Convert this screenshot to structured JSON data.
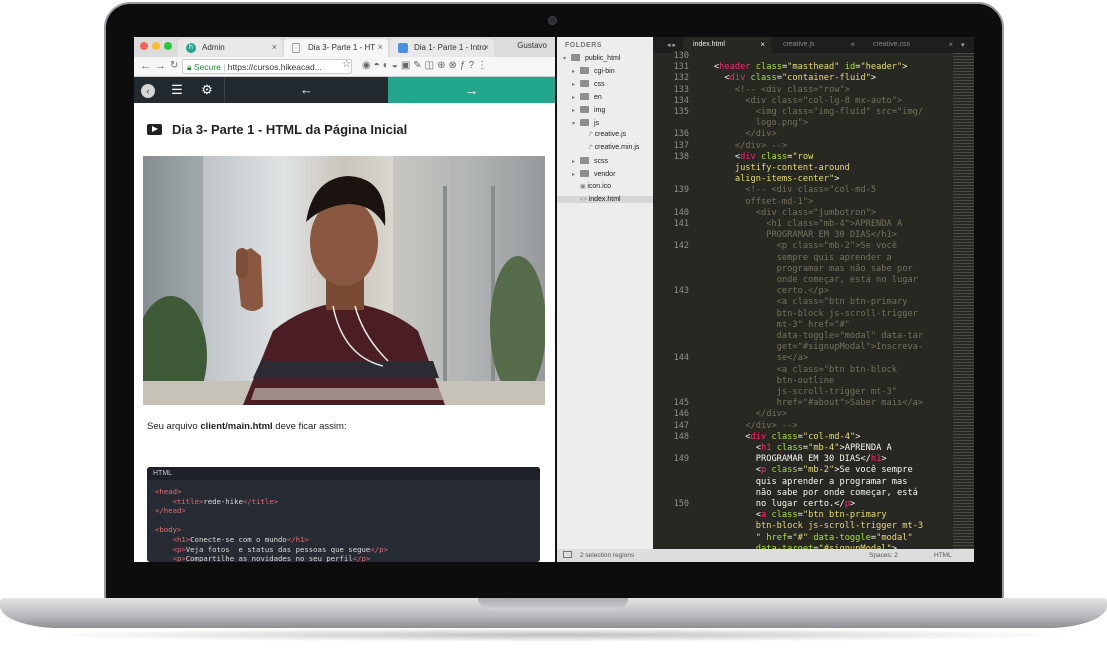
{
  "browser": {
    "tabs": [
      {
        "label": "Admin",
        "icon": "hike-logo-icon"
      },
      {
        "label": "Dia 3- Parte 1 - HT",
        "icon": "page-icon"
      },
      {
        "label": "Dia 1- Parte 1 - Intro",
        "icon": "page-icon"
      }
    ],
    "user": "Gustavo",
    "secure_label": "Secure",
    "url": "https://cursos.hikeacad...",
    "lesson_title": "Dia 3- Parte 1 - HTML da Página Inicial",
    "paragraph_prefix": "Seu arquivo ",
    "paragraph_file": "client/main.html",
    "paragraph_suffix": " deve ficar assim:",
    "code_lang": "HTML",
    "code_lines": [
      {
        "indent": "",
        "open": "<head>",
        "text": "",
        "close": ""
      },
      {
        "indent": "    ",
        "open": "<title>",
        "text": "rede-hike",
        "close": "</title>"
      },
      {
        "indent": "",
        "open": "</head>",
        "text": "",
        "close": ""
      },
      {
        "indent": "",
        "open": "",
        "text": "",
        "close": ""
      },
      {
        "indent": "",
        "open": "<body>",
        "text": "",
        "close": ""
      },
      {
        "indent": "    ",
        "open": "<h1>",
        "text": "Conecte-se com o mundo",
        "close": "</h1>"
      },
      {
        "indent": "    ",
        "open": "<p>",
        "text": "Veja fotos  e status das pessoas que segue",
        "close": "</p>"
      },
      {
        "indent": "    ",
        "open": "<p>",
        "text": "Compartilhe as novidades no seu perfil",
        "close": "</p>"
      }
    ]
  },
  "editor": {
    "folders_label": "FOLDERS",
    "tree": [
      {
        "label": "public_html",
        "depth": 0,
        "type": "folder",
        "open": true
      },
      {
        "label": "cgi-bin",
        "depth": 1,
        "type": "folder"
      },
      {
        "label": "css",
        "depth": 1,
        "type": "folder"
      },
      {
        "label": "en",
        "depth": 1,
        "type": "folder"
      },
      {
        "label": "img",
        "depth": 1,
        "type": "folder"
      },
      {
        "label": "js",
        "depth": 1,
        "type": "folder",
        "open": true
      },
      {
        "label": "creative.js",
        "depth": 2,
        "type": "file"
      },
      {
        "label": "creative.min.js",
        "depth": 2,
        "type": "file"
      },
      {
        "label": "scss",
        "depth": 1,
        "type": "folder"
      },
      {
        "label": "vendor",
        "depth": 1,
        "type": "folder"
      },
      {
        "label": "icon.ico",
        "depth": 1,
        "type": "file"
      },
      {
        "label": "index.html",
        "depth": 1,
        "type": "file",
        "selected": true
      }
    ],
    "tabs": [
      {
        "label": "index.html",
        "active": true
      },
      {
        "label": "creative.js",
        "active": false
      },
      {
        "label": "creative.css",
        "active": false
      }
    ],
    "line_numbers": [
      {
        "n": "130",
        "row": 0
      },
      {
        "n": "131",
        "row": 1
      },
      {
        "n": "132",
        "row": 2
      },
      {
        "n": "133",
        "row": 3
      },
      {
        "n": "134",
        "row": 4
      },
      {
        "n": "135",
        "row": 5
      },
      {
        "n": "136",
        "row": 7
      },
      {
        "n": "137",
        "row": 8
      },
      {
        "n": "138",
        "row": 9
      },
      {
        "n": "139",
        "row": 12
      },
      {
        "n": "140",
        "row": 14
      },
      {
        "n": "141",
        "row": 15
      },
      {
        "n": "142",
        "row": 17
      },
      {
        "n": "143",
        "row": 21
      },
      {
        "n": "144",
        "row": 27
      },
      {
        "n": "145",
        "row": 31
      },
      {
        "n": "146",
        "row": 32
      },
      {
        "n": "147",
        "row": 33
      },
      {
        "n": "148",
        "row": 34
      },
      {
        "n": "149",
        "row": 36
      },
      {
        "n": "150",
        "row": 40
      }
    ],
    "code_lines": [
      [
        {
          "c": "w",
          "t": ""
        }
      ],
      [
        {
          "c": "w",
          "t": "    <"
        },
        {
          "c": "k",
          "t": "header"
        },
        {
          "c": "a",
          "t": " class"
        },
        {
          "c": "w",
          "t": "="
        },
        {
          "c": "s",
          "t": "\"masthead\""
        },
        {
          "c": "a",
          "t": " id"
        },
        {
          "c": "w",
          "t": "="
        },
        {
          "c": "s",
          "t": "\"header\""
        },
        {
          "c": "w",
          "t": ">"
        }
      ],
      [
        {
          "c": "w",
          "t": "      <"
        },
        {
          "c": "k",
          "t": "div"
        },
        {
          "c": "a",
          "t": " class"
        },
        {
          "c": "w",
          "t": "="
        },
        {
          "c": "s",
          "t": "\"container-fluid\""
        },
        {
          "c": "w",
          "t": ">"
        }
      ],
      [
        {
          "c": "c",
          "t": "        <!-- <div class=\"row\">"
        }
      ],
      [
        {
          "c": "c",
          "t": "          <div class=\"col-lg-8 mx-auto\">"
        }
      ],
      [
        {
          "c": "c",
          "t": "            <img class=\"img-fluid\" src=\"img/"
        }
      ],
      [
        {
          "c": "c",
          "t": "            logo.png\">"
        }
      ],
      [
        {
          "c": "c",
          "t": "          </div>"
        }
      ],
      [
        {
          "c": "c",
          "t": "        </div> -->"
        }
      ],
      [
        {
          "c": "w",
          "t": "        <"
        },
        {
          "c": "k",
          "t": "div"
        },
        {
          "c": "a",
          "t": " class"
        },
        {
          "c": "w",
          "t": "="
        },
        {
          "c": "s",
          "t": "\"row"
        }
      ],
      [
        {
          "c": "s",
          "t": "        justify-content-around"
        }
      ],
      [
        {
          "c": "s",
          "t": "        align-items-center\""
        },
        {
          "c": "w",
          "t": ">"
        }
      ],
      [
        {
          "c": "c",
          "t": "          <!-- <div class=\"col-md-5"
        }
      ],
      [
        {
          "c": "c",
          "t": "          offset-md-1\">"
        }
      ],
      [
        {
          "c": "c",
          "t": "            <div class=\"jumbotron\">"
        }
      ],
      [
        {
          "c": "c",
          "t": "              <h1 class=\"mb-4\">APRENDA A"
        }
      ],
      [
        {
          "c": "c",
          "t": "              PROGRAMAR EM 30 DIAS</h1>"
        }
      ],
      [
        {
          "c": "c",
          "t": "                <p class=\"mb-2\">Se você"
        }
      ],
      [
        {
          "c": "c",
          "t": "                sempre quis aprender a"
        }
      ],
      [
        {
          "c": "c",
          "t": "                programar mas não sabe por"
        }
      ],
      [
        {
          "c": "c",
          "t": "                onde começar, está no lugar"
        }
      ],
      [
        {
          "c": "c",
          "t": "                certo.</p>"
        }
      ],
      [
        {
          "c": "c",
          "t": "                <a class=\"btn btn-primary"
        }
      ],
      [
        {
          "c": "c",
          "t": "                btn-block js-scroll-trigger"
        }
      ],
      [
        {
          "c": "c",
          "t": "                mt-3\" href=\"#\""
        }
      ],
      [
        {
          "c": "c",
          "t": "                data-toggle=\"modal\" data-tar"
        }
      ],
      [
        {
          "c": "c",
          "t": "                get=\"#signupModal\">Inscreva-"
        }
      ],
      [
        {
          "c": "c",
          "t": "                se</a>"
        }
      ],
      [
        {
          "c": "c",
          "t": "                <a class=\"btn btn-block"
        }
      ],
      [
        {
          "c": "c",
          "t": "                btn-outline"
        }
      ],
      [
        {
          "c": "c",
          "t": "                js-scroll-trigger mt-3\""
        }
      ],
      [
        {
          "c": "c",
          "t": "                href=\"#about\">Saber mais</a>"
        }
      ],
      [
        {
          "c": "c",
          "t": "            </div>"
        }
      ],
      [
        {
          "c": "c",
          "t": "          </div> -->"
        }
      ],
      [
        {
          "c": "w",
          "t": "          <"
        },
        {
          "c": "k",
          "t": "div"
        },
        {
          "c": "a",
          "t": " class"
        },
        {
          "c": "w",
          "t": "="
        },
        {
          "c": "s",
          "t": "\"col-md-4\""
        },
        {
          "c": "w",
          "t": ">"
        }
      ],
      [
        {
          "c": "w",
          "t": "            <"
        },
        {
          "c": "k",
          "t": "h1"
        },
        {
          "c": "a",
          "t": " class"
        },
        {
          "c": "w",
          "t": "="
        },
        {
          "c": "s",
          "t": "\"mb-4\""
        },
        {
          "c": "w",
          "t": ">APRENDA A"
        }
      ],
      [
        {
          "c": "w",
          "t": "            PROGRAMAR EM 30 DIAS</"
        },
        {
          "c": "k",
          "t": "h1"
        },
        {
          "c": "w",
          "t": ">"
        }
      ],
      [
        {
          "c": "w",
          "t": "            <"
        },
        {
          "c": "k",
          "t": "p"
        },
        {
          "c": "a",
          "t": " class"
        },
        {
          "c": "w",
          "t": "="
        },
        {
          "c": "s",
          "t": "\"mb-2\""
        },
        {
          "c": "w",
          "t": ">Se você sempre"
        }
      ],
      [
        {
          "c": "w",
          "t": "            quis aprender a programar mas"
        }
      ],
      [
        {
          "c": "w",
          "t": "            não sabe por onde começar, está"
        }
      ],
      [
        {
          "c": "w",
          "t": "            no lugar certo.</"
        },
        {
          "c": "k",
          "t": "p"
        },
        {
          "c": "w",
          "t": ">"
        }
      ],
      [
        {
          "c": "w",
          "t": "            <"
        },
        {
          "c": "k",
          "t": "a"
        },
        {
          "c": "a",
          "t": " class"
        },
        {
          "c": "w",
          "t": "="
        },
        {
          "c": "s",
          "t": "\"btn btn-primary"
        }
      ],
      [
        {
          "c": "s",
          "t": "            btn-block js-scroll-trigger mt-3"
        }
      ],
      [
        {
          "c": "s",
          "t": "            \""
        },
        {
          "c": "a",
          "t": " href"
        },
        {
          "c": "w",
          "t": "="
        },
        {
          "c": "s",
          "t": "\"#\""
        },
        {
          "c": "a",
          "t": " data-toggle"
        },
        {
          "c": "w",
          "t": "="
        },
        {
          "c": "s",
          "t": "\"modal\""
        }
      ],
      [
        {
          "c": "a",
          "t": "            data-target"
        },
        {
          "c": "w",
          "t": "="
        },
        {
          "c": "s",
          "t": "\"#signupModal\""
        },
        {
          "c": "w",
          "t": ">"
        }
      ]
    ],
    "status_left": "2 selection regions",
    "status_spaces": "Spaces: 2",
    "status_syntax": "HTML"
  }
}
